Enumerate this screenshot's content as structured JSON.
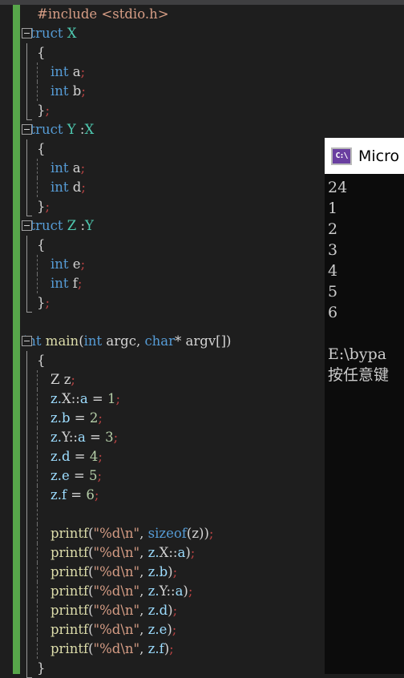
{
  "window": {
    "editor_background": "#1e1e1e",
    "change_bar_color": "#57a64a",
    "top_strip_color": "#3f3f41"
  },
  "editor": {
    "language": "C++",
    "current_line_index": 21,
    "lines": [
      {
        "indent": 1,
        "fold": false,
        "guide": "none",
        "tokens": [
          {
            "t": "#include <stdio.h>",
            "c": "str"
          }
        ]
      },
      {
        "indent": 0,
        "fold": true,
        "guide": "none",
        "tokens": [
          {
            "t": "struct",
            "c": "kw"
          },
          {
            "t": " ",
            "c": "plain"
          },
          {
            "t": "X",
            "c": "type"
          }
        ]
      },
      {
        "indent": 1,
        "fold": false,
        "guide": "solid",
        "tokens": [
          {
            "t": "{",
            "c": "punct"
          }
        ]
      },
      {
        "indent": 2,
        "fold": false,
        "guide": "dash",
        "tokens": [
          {
            "t": "int",
            "c": "kw"
          },
          {
            "t": " ",
            "c": "plain"
          },
          {
            "t": "a",
            "c": "plain"
          },
          {
            "t": ";",
            "c": "semi"
          }
        ]
      },
      {
        "indent": 2,
        "fold": false,
        "guide": "dash",
        "tokens": [
          {
            "t": "int",
            "c": "kw"
          },
          {
            "t": " ",
            "c": "plain"
          },
          {
            "t": "b",
            "c": "plain"
          },
          {
            "t": ";",
            "c": "semi"
          }
        ]
      },
      {
        "indent": 1,
        "fold": false,
        "guide": "solidend",
        "tokens": [
          {
            "t": "}",
            "c": "punct"
          },
          {
            "t": ";",
            "c": "semi"
          }
        ]
      },
      {
        "indent": 0,
        "fold": true,
        "guide": "none",
        "tokens": [
          {
            "t": "struct",
            "c": "kw"
          },
          {
            "t": " ",
            "c": "plain"
          },
          {
            "t": "Y",
            "c": "type"
          },
          {
            "t": " :",
            "c": "plain"
          },
          {
            "t": "X",
            "c": "type"
          }
        ]
      },
      {
        "indent": 1,
        "fold": false,
        "guide": "solid",
        "tokens": [
          {
            "t": "{",
            "c": "punct"
          }
        ]
      },
      {
        "indent": 2,
        "fold": false,
        "guide": "dash",
        "tokens": [
          {
            "t": "int",
            "c": "kw"
          },
          {
            "t": " ",
            "c": "plain"
          },
          {
            "t": "a",
            "c": "plain"
          },
          {
            "t": ";",
            "c": "semi"
          }
        ]
      },
      {
        "indent": 2,
        "fold": false,
        "guide": "dash",
        "tokens": [
          {
            "t": "int",
            "c": "kw"
          },
          {
            "t": " ",
            "c": "plain"
          },
          {
            "t": "d",
            "c": "plain"
          },
          {
            "t": ";",
            "c": "semi"
          }
        ]
      },
      {
        "indent": 1,
        "fold": false,
        "guide": "solidend",
        "tokens": [
          {
            "t": "}",
            "c": "punct"
          },
          {
            "t": ";",
            "c": "semi"
          }
        ]
      },
      {
        "indent": 0,
        "fold": true,
        "guide": "none",
        "tokens": [
          {
            "t": "struct",
            "c": "kw"
          },
          {
            "t": " ",
            "c": "plain"
          },
          {
            "t": "Z",
            "c": "type"
          },
          {
            "t": " :",
            "c": "plain"
          },
          {
            "t": "Y",
            "c": "type"
          }
        ]
      },
      {
        "indent": 1,
        "fold": false,
        "guide": "solid",
        "tokens": [
          {
            "t": "{",
            "c": "punct"
          }
        ]
      },
      {
        "indent": 2,
        "fold": false,
        "guide": "dash",
        "tokens": [
          {
            "t": "int",
            "c": "kw"
          },
          {
            "t": " ",
            "c": "plain"
          },
          {
            "t": "e",
            "c": "plain"
          },
          {
            "t": ";",
            "c": "semi"
          }
        ]
      },
      {
        "indent": 2,
        "fold": false,
        "guide": "dash",
        "tokens": [
          {
            "t": "int",
            "c": "kw"
          },
          {
            "t": " ",
            "c": "plain"
          },
          {
            "t": "f",
            "c": "plain"
          },
          {
            "t": ";",
            "c": "semi"
          }
        ]
      },
      {
        "indent": 1,
        "fold": false,
        "guide": "solidend",
        "tokens": [
          {
            "t": "}",
            "c": "punct"
          },
          {
            "t": ";",
            "c": "semi"
          }
        ]
      },
      {
        "indent": 0,
        "fold": false,
        "guide": "none",
        "tokens": []
      },
      {
        "indent": 0,
        "fold": true,
        "guide": "none",
        "tokens": [
          {
            "t": "int",
            "c": "kw"
          },
          {
            "t": " ",
            "c": "plain"
          },
          {
            "t": "main",
            "c": "fn"
          },
          {
            "t": "(",
            "c": "punct"
          },
          {
            "t": "int",
            "c": "kw"
          },
          {
            "t": " argc, ",
            "c": "plain"
          },
          {
            "t": "char",
            "c": "kw"
          },
          {
            "t": "* argv[])",
            "c": "plain"
          }
        ]
      },
      {
        "indent": 1,
        "fold": false,
        "guide": "solid",
        "tokens": [
          {
            "t": "{",
            "c": "punct"
          }
        ]
      },
      {
        "indent": 2,
        "fold": false,
        "guide": "dash",
        "tokens": [
          {
            "t": "Z",
            "c": "plain"
          },
          {
            "t": " ",
            "c": "plain"
          },
          {
            "t": "z",
            "c": "plain"
          },
          {
            "t": ";",
            "c": "semi"
          }
        ]
      },
      {
        "indent": 2,
        "fold": false,
        "guide": "dash",
        "tokens": [
          {
            "t": "z.",
            "c": "ident"
          },
          {
            "t": "X",
            "c": "plain"
          },
          {
            "t": "::",
            "c": "plain"
          },
          {
            "t": "a",
            "c": "ident"
          },
          {
            "t": " = ",
            "c": "op"
          },
          {
            "t": "1",
            "c": "num"
          },
          {
            "t": ";",
            "c": "semi"
          }
        ]
      },
      {
        "indent": 2,
        "fold": false,
        "guide": "dash",
        "tokens": [
          {
            "t": "z.",
            "c": "ident"
          },
          {
            "t": "b",
            "c": "ident"
          },
          {
            "t": " = ",
            "c": "op"
          },
          {
            "t": "2",
            "c": "num"
          },
          {
            "t": ";",
            "c": "semi"
          }
        ]
      },
      {
        "indent": 2,
        "fold": false,
        "guide": "dash",
        "tokens": [
          {
            "t": "z.",
            "c": "ident"
          },
          {
            "t": "Y",
            "c": "plain"
          },
          {
            "t": "::",
            "c": "plain"
          },
          {
            "t": "a",
            "c": "ident"
          },
          {
            "t": " = ",
            "c": "op"
          },
          {
            "t": "3",
            "c": "num"
          },
          {
            "t": ";",
            "c": "semi"
          }
        ]
      },
      {
        "indent": 2,
        "fold": false,
        "guide": "dash",
        "tokens": [
          {
            "t": "z.",
            "c": "ident"
          },
          {
            "t": "d",
            "c": "ident"
          },
          {
            "t": " = ",
            "c": "op"
          },
          {
            "t": "4",
            "c": "num"
          },
          {
            "t": ";",
            "c": "semi"
          }
        ]
      },
      {
        "indent": 2,
        "fold": false,
        "guide": "dash",
        "tokens": [
          {
            "t": "z.",
            "c": "ident"
          },
          {
            "t": "e",
            "c": "ident"
          },
          {
            "t": " = ",
            "c": "op"
          },
          {
            "t": "5",
            "c": "num"
          },
          {
            "t": ";",
            "c": "semi"
          }
        ]
      },
      {
        "indent": 2,
        "fold": false,
        "guide": "dash",
        "tokens": [
          {
            "t": "z.",
            "c": "ident"
          },
          {
            "t": "f",
            "c": "ident"
          },
          {
            "t": " = ",
            "c": "op"
          },
          {
            "t": "6",
            "c": "num"
          },
          {
            "t": ";",
            "c": "semi"
          }
        ]
      },
      {
        "indent": 2,
        "fold": false,
        "guide": "dash",
        "tokens": []
      },
      {
        "indent": 2,
        "fold": false,
        "guide": "dash",
        "tokens": [
          {
            "t": "printf",
            "c": "fn"
          },
          {
            "t": "(",
            "c": "punct"
          },
          {
            "t": "\"%d\\n\"",
            "c": "str"
          },
          {
            "t": ", ",
            "c": "plain"
          },
          {
            "t": "sizeof",
            "c": "kw"
          },
          {
            "t": "(z))",
            "c": "plain"
          },
          {
            "t": ";",
            "c": "semi"
          }
        ]
      },
      {
        "indent": 2,
        "fold": false,
        "guide": "dash",
        "tokens": [
          {
            "t": "printf",
            "c": "fn"
          },
          {
            "t": "(",
            "c": "punct"
          },
          {
            "t": "\"%d\\n\"",
            "c": "str"
          },
          {
            "t": ", ",
            "c": "plain"
          },
          {
            "t": "z.",
            "c": "ident"
          },
          {
            "t": "X",
            "c": "plain"
          },
          {
            "t": "::",
            "c": "plain"
          },
          {
            "t": "a",
            "c": "ident"
          },
          {
            "t": ")",
            "c": "punct"
          },
          {
            "t": ";",
            "c": "semi"
          }
        ]
      },
      {
        "indent": 2,
        "fold": false,
        "guide": "dash",
        "tokens": [
          {
            "t": "printf",
            "c": "fn"
          },
          {
            "t": "(",
            "c": "punct"
          },
          {
            "t": "\"%d\\n\"",
            "c": "str"
          },
          {
            "t": ", ",
            "c": "plain"
          },
          {
            "t": "z.",
            "c": "ident"
          },
          {
            "t": "b",
            "c": "ident"
          },
          {
            "t": ")",
            "c": "punct"
          },
          {
            "t": ";",
            "c": "semi"
          }
        ]
      },
      {
        "indent": 2,
        "fold": false,
        "guide": "dash",
        "tokens": [
          {
            "t": "printf",
            "c": "fn"
          },
          {
            "t": "(",
            "c": "punct"
          },
          {
            "t": "\"%d\\n\"",
            "c": "str"
          },
          {
            "t": ", ",
            "c": "plain"
          },
          {
            "t": "z.",
            "c": "ident"
          },
          {
            "t": "Y",
            "c": "plain"
          },
          {
            "t": "::",
            "c": "plain"
          },
          {
            "t": "a",
            "c": "ident"
          },
          {
            "t": ")",
            "c": "punct"
          },
          {
            "t": ";",
            "c": "semi"
          }
        ]
      },
      {
        "indent": 2,
        "fold": false,
        "guide": "dash",
        "tokens": [
          {
            "t": "printf",
            "c": "fn"
          },
          {
            "t": "(",
            "c": "punct"
          },
          {
            "t": "\"%d\\n\"",
            "c": "str"
          },
          {
            "t": ", ",
            "c": "plain"
          },
          {
            "t": "z.",
            "c": "ident"
          },
          {
            "t": "d",
            "c": "ident"
          },
          {
            "t": ")",
            "c": "punct"
          },
          {
            "t": ";",
            "c": "semi"
          }
        ]
      },
      {
        "indent": 2,
        "fold": false,
        "guide": "dash",
        "tokens": [
          {
            "t": "printf",
            "c": "fn"
          },
          {
            "t": "(",
            "c": "punct"
          },
          {
            "t": "\"%d\\n\"",
            "c": "str"
          },
          {
            "t": ", ",
            "c": "plain"
          },
          {
            "t": "z.",
            "c": "ident"
          },
          {
            "t": "e",
            "c": "ident"
          },
          {
            "t": ")",
            "c": "punct"
          },
          {
            "t": ";",
            "c": "semi"
          }
        ]
      },
      {
        "indent": 2,
        "fold": false,
        "guide": "dash",
        "tokens": [
          {
            "t": "printf",
            "c": "fn"
          },
          {
            "t": "(",
            "c": "punct"
          },
          {
            "t": "\"%d\\n\"",
            "c": "str"
          },
          {
            "t": ", ",
            "c": "plain"
          },
          {
            "t": "z.",
            "c": "ident"
          },
          {
            "t": "f",
            "c": "ident"
          },
          {
            "t": ")",
            "c": "punct"
          },
          {
            "t": ";",
            "c": "semi"
          }
        ]
      },
      {
        "indent": 1,
        "fold": false,
        "guide": "solidend",
        "tokens": [
          {
            "t": "}",
            "c": "punct"
          }
        ]
      }
    ]
  },
  "console": {
    "icon_name": "console-cmd-icon",
    "icon_glyph": "C:\\",
    "title": "Micro",
    "output_lines": [
      "24",
      "1",
      "2",
      "3",
      "4",
      "5",
      "6",
      "",
      "E:\\bypa",
      "按任意键"
    ]
  }
}
